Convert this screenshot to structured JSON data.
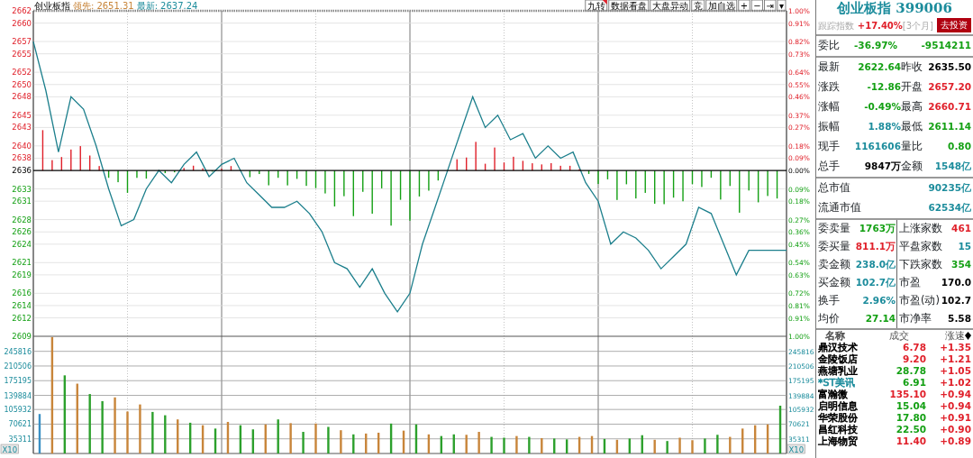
{
  "header": {
    "index_name": "创业板指",
    "lead_label": "领先:",
    "lead_value": "2651.31",
    "latest_label": "最新:",
    "latest_value": "2637.24"
  },
  "toolbar": [
    {
      "label": "九转",
      "flagged": true
    },
    {
      "label": "数据看盘",
      "flagged": false
    },
    {
      "label": "大盘异动",
      "flagged": false
    },
    {
      "label": "竞",
      "flagged": false
    },
    {
      "label": "加自选",
      "flagged": false
    },
    {
      "label": "+",
      "flagged": false
    },
    {
      "label": "−",
      "flagged": false
    },
    {
      "label": "⇥",
      "flagged": false
    },
    {
      "label": "▾",
      "flagged": false
    }
  ],
  "price_chart": {
    "chart_data": {
      "type": "line",
      "grid": true,
      "series": [
        {
          "color": "#1c7f8c",
          "values": [
            2657,
            2649,
            2639,
            2648,
            2646,
            2640,
            2633,
            2627,
            2628,
            2633,
            2636,
            2634,
            2637,
            2639,
            2635,
            2637,
            2638,
            2634,
            2632,
            2630,
            2630,
            2631,
            2629,
            2626,
            2621,
            2620,
            2617,
            2620,
            2616,
            2613,
            2616,
            2624,
            2630,
            2636,
            2642,
            2648,
            2643,
            2645,
            2641,
            2642,
            2638,
            2640,
            2638,
            2639,
            2634,
            2631,
            2624,
            2626,
            2625,
            2623,
            2620,
            2622,
            2624,
            2630,
            2629,
            2624,
            2619,
            2623,
            2623,
            2623,
            2623
          ]
        }
      ],
      "ylim": [
        2609,
        2662
      ],
      "yticks": [
        2662,
        2660,
        2657,
        2655,
        2652,
        2650,
        2648,
        2645,
        2643,
        2640,
        2638,
        2636,
        2633,
        2631,
        2628,
        2626,
        2624,
        2621,
        2619,
        2616,
        2614,
        2612,
        2609
      ]
    },
    "right_labels": [
      "1.00%",
      "0.91%",
      "0.82%",
      "0.73%",
      "0.64%",
      "0.55%",
      "0.46%",
      "0.37%",
      "0.27%",
      "0.18%",
      "0.09%",
      "0.00%",
      "0.09%",
      "0.18%",
      "0.27%",
      "0.36%",
      "0.45%",
      "0.54%",
      "0.63%",
      "0.72%",
      "0.81%",
      "0.91%",
      "1.00%"
    ]
  },
  "volume_chart": {
    "chart_data": {
      "type": "bar",
      "stacked": true,
      "grid": true,
      "series": [
        {
          "color": "#3a8fc4",
          "values": [
            95000,
            null,
            null,
            null,
            null,
            null,
            null,
            null,
            null,
            null,
            null,
            null,
            null,
            null,
            null,
            null,
            null,
            null,
            null,
            null,
            null,
            null,
            null,
            null,
            null,
            null,
            null,
            null,
            null,
            null,
            null,
            null,
            null,
            null,
            null,
            null,
            null,
            null,
            null,
            null,
            null,
            null,
            null,
            null,
            null,
            null,
            null,
            null,
            null,
            null,
            null,
            null,
            null,
            null,
            null,
            null,
            null,
            null,
            null,
            null
          ]
        },
        {
          "color": "#c8853a",
          "values": [
            null,
            280000,
            null,
            168000,
            null,
            null,
            135000,
            101000,
            118000,
            null,
            null,
            82000,
            null,
            68000,
            null,
            76000,
            null,
            null,
            70000,
            null,
            73000,
            null,
            72000,
            null,
            56000,
            null,
            48000,
            50000,
            null,
            55000,
            null,
            46000,
            null,
            null,
            45000,
            52000,
            null,
            null,
            42000,
            null,
            37000,
            null,
            null,
            40000,
            42000,
            null,
            33000,
            null,
            null,
            33000,
            null,
            38000,
            32000,
            null,
            null,
            40000,
            60000,
            68000,
            70000,
            null
          ]
        },
        {
          "color": "#2ca02c",
          "values": [
            null,
            null,
            188000,
            null,
            143000,
            126000,
            null,
            null,
            null,
            100000,
            92000,
            null,
            74000,
            null,
            60000,
            null,
            68000,
            58000,
            null,
            82000,
            null,
            52000,
            null,
            64000,
            null,
            46000,
            null,
            null,
            72000,
            null,
            70000,
            null,
            42000,
            46000,
            null,
            null,
            40000,
            38000,
            null,
            40000,
            null,
            36000,
            34000,
            null,
            null,
            35000,
            null,
            36000,
            44000,
            null,
            30000,
            null,
            null,
            36000,
            45000,
            null,
            null,
            null,
            null,
            115000
          ]
        }
      ],
      "ylim": [
        0,
        282000
      ],
      "yticks": [
        35311,
        70621,
        105932,
        139884,
        175195,
        210506,
        245816
      ]
    },
    "right_labels": [
      "245816",
      "210506",
      "175195",
      "139884",
      "105932",
      "70621",
      "35311"
    ],
    "units": [
      "X10",
      "X10"
    ]
  },
  "panel": {
    "title": "创业板指 399006",
    "track": {
      "label": "跟踪指数",
      "value": "+17.40%",
      "period": "[3个月]",
      "button": "去投资"
    },
    "ratio": {
      "label": "委比",
      "percent": "-36.97%",
      "difference": "-9514211"
    },
    "quotes": [
      [
        {
          "label": "最新",
          "value": "2622.64",
          "color": "#14a014"
        },
        {
          "label": "昨收",
          "value": "2635.50",
          "color": "#000000"
        }
      ],
      [
        {
          "label": "涨跌",
          "value": "-12.86",
          "color": "#14a014"
        },
        {
          "label": "开盘",
          "value": "2657.20",
          "color": "#e0202a"
        }
      ],
      [
        {
          "label": "涨幅",
          "value": "-0.49%",
          "color": "#14a014"
        },
        {
          "label": "最高",
          "value": "2660.71",
          "color": "#e0202a"
        }
      ],
      [
        {
          "label": "振幅",
          "value": "1.88%",
          "color": "#1c8c9c"
        },
        {
          "label": "最低",
          "value": "2611.14",
          "color": "#14a014"
        }
      ],
      [
        {
          "label": "现手",
          "value": "1161606",
          "color": "#1c8c9c"
        },
        {
          "label": "量比",
          "value": "0.80",
          "color": "#14a014"
        }
      ],
      [
        {
          "label": "总手",
          "value": "9847万",
          "color": "#000000"
        },
        {
          "label": "金额",
          "value": "1548亿",
          "color": "#1c8c9c"
        }
      ]
    ],
    "market_value": [
      {
        "label": "总市值",
        "value": "90235亿"
      },
      {
        "label": "流通市值",
        "value": "62534亿"
      }
    ],
    "stats": [
      [
        {
          "label": "委卖量",
          "value": "1763万",
          "color": "#14a014"
        },
        {
          "label": "上涨家数",
          "value": "461",
          "color": "#e0202a"
        }
      ],
      [
        {
          "label": "委买量",
          "value": "811.1万",
          "color": "#e0202a"
        },
        {
          "label": "平盘家数",
          "value": "15",
          "color": "#1c8c9c"
        }
      ],
      [
        {
          "label": "卖金额",
          "value": "238.0亿",
          "color": "#1c8c9c"
        },
        {
          "label": "下跌家数",
          "value": "354",
          "color": "#14a014"
        }
      ],
      [
        {
          "label": "买金额",
          "value": "102.7亿",
          "color": "#1c8c9c"
        },
        {
          "label": "市盈",
          "value": "170.0",
          "color": "#000000"
        }
      ],
      [
        {
          "label": "换手",
          "value": "2.96%",
          "color": "#1c8c9c"
        },
        {
          "label": "市盈(动)",
          "value": "102.7",
          "color": "#000000"
        }
      ],
      [
        {
          "label": "均价",
          "value": "27.14",
          "color": "#14a014"
        },
        {
          "label": "市净率",
          "value": "5.58",
          "color": "#000000"
        }
      ]
    ],
    "list_columns": [
      "名称",
      "成交",
      "涨速"
    ],
    "stocks": [
      {
        "name": {
          "text": "鼎汉技术",
          "color": "#000000"
        },
        "price": {
          "text": "6.78",
          "color": "#e0202a"
        },
        "speed": "+1.35"
      },
      {
        "name": {
          "text": "金陵饭店",
          "color": "#000000"
        },
        "price": {
          "text": "9.20",
          "color": "#e0202a"
        },
        "speed": "+1.21"
      },
      {
        "name": {
          "text": "燕塘乳业",
          "color": "#000000"
        },
        "price": {
          "text": "28.78",
          "color": "#14a014"
        },
        "speed": "+1.05"
      },
      {
        "name": {
          "text": "*ST美讯",
          "color": "#1c8c9c"
        },
        "price": {
          "text": "6.91",
          "color": "#14a014"
        },
        "speed": "+1.02"
      },
      {
        "name": {
          "text": "富瀚微",
          "color": "#000000"
        },
        "price": {
          "text": "135.10",
          "color": "#e0202a"
        },
        "speed": "+0.94"
      },
      {
        "name": {
          "text": "启明信息",
          "color": "#000000"
        },
        "price": {
          "text": "15.04",
          "color": "#14a014"
        },
        "speed": "+0.94"
      },
      {
        "name": {
          "text": "华荣股份",
          "color": "#000000"
        },
        "price": {
          "text": "17.80",
          "color": "#14a014"
        },
        "speed": "+0.91"
      },
      {
        "name": {
          "text": "昌红科技",
          "color": "#000000"
        },
        "price": {
          "text": "22.50",
          "color": "#14a014"
        },
        "speed": "+0.90"
      },
      {
        "name": {
          "text": "上海物贸",
          "color": "#000000"
        },
        "price": {
          "text": "11.40",
          "color": "#e0202a"
        },
        "speed": "+0.89"
      }
    ]
  }
}
